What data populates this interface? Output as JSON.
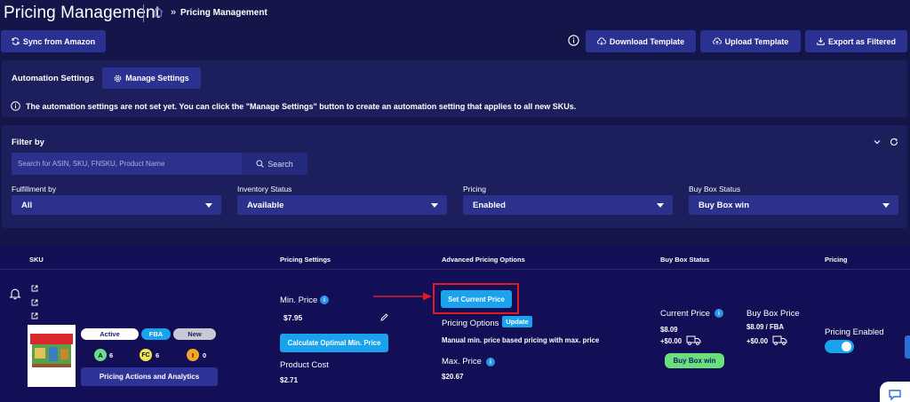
{
  "header": {
    "title": "Pricing Management",
    "breadcrumb_sep": "»",
    "breadcrumb_current": "Pricing Management"
  },
  "toolbar": {
    "sync_label": "Sync from Amazon",
    "download_label": "Download Template",
    "upload_label": "Upload Template",
    "export_label": "Export as Filtered"
  },
  "automation": {
    "label": "Automation Settings",
    "manage_label": "Manage Settings",
    "notice": "The automation settings are not set yet. You can click the \"Manage Settings\" button to create an automation setting that applies to all new SKUs."
  },
  "filter": {
    "title": "Filter by",
    "search_placeholder": "Search for ASIN, SKU, FNSKU, Product Name",
    "search_button": "Search",
    "fulfillment": {
      "label": "Fulfillment by",
      "value": "All"
    },
    "inventory": {
      "label": "Inventory Status",
      "value": "Available"
    },
    "pricing": {
      "label": "Pricing",
      "value": "Enabled"
    },
    "buybox": {
      "label": "Buy Box Status",
      "value": "Buy Box win"
    }
  },
  "table": {
    "headers": {
      "sku": "SKU",
      "pricing_settings": "Pricing Settings",
      "advanced": "Advanced Pricing Options",
      "buybox_status": "Buy Box Status",
      "pricing": "Pricing"
    },
    "row": {
      "badges": {
        "active": "Active",
        "fba": "FBA",
        "new": "New"
      },
      "counts": {
        "a_letter": "A",
        "a_value": "6",
        "fc_letter": "FC",
        "fc_value": "6",
        "i_letter": "I",
        "i_value": "0"
      },
      "actions_label": "Pricing Actions and Analytics",
      "min_price_label": "Min. Price",
      "min_price_value": "$7.95",
      "calc_label": "Calculate Optimal Min. Price",
      "product_cost_label": "Product Cost",
      "product_cost_value": "$2.71",
      "set_current_label": "Set Current Price",
      "pricing_options_label": "Pricing Options",
      "update_label": "Update",
      "pricing_options_desc": "Manual min. price based pricing with max. price",
      "max_price_label": "Max. Price",
      "max_price_value": "$20.67",
      "current_price_label": "Current Price",
      "current_price_value": "$8.09",
      "current_shipping": "+$0.00",
      "buybox_price_label": "Buy Box Price",
      "buybox_price_value": "$8.09 / FBA",
      "buybox_shipping": "+$0.00",
      "buybox_win_label": "Buy Box win",
      "pricing_enabled_label": "Pricing Enabled",
      "pricing_enabled_on": true
    }
  },
  "colors": {
    "bg": "#14164a",
    "panel": "#1c1f5c",
    "button": "#2b3190",
    "accent": "#1aa3ec",
    "highlight": "#e01b24",
    "success": "#69e07a"
  },
  "icons": {
    "home": "home-icon",
    "sync": "sync-icon",
    "info": "info-icon",
    "download": "cloud-download-icon",
    "upload": "cloud-upload-icon",
    "export": "download-icon",
    "gear": "gear-icon",
    "bell": "bell-icon",
    "external": "external-link-icon",
    "edit": "pencil-icon",
    "truck": "truck-icon",
    "chevron": "chevron-down-icon",
    "refresh": "refresh-icon",
    "chat": "chat-icon"
  }
}
